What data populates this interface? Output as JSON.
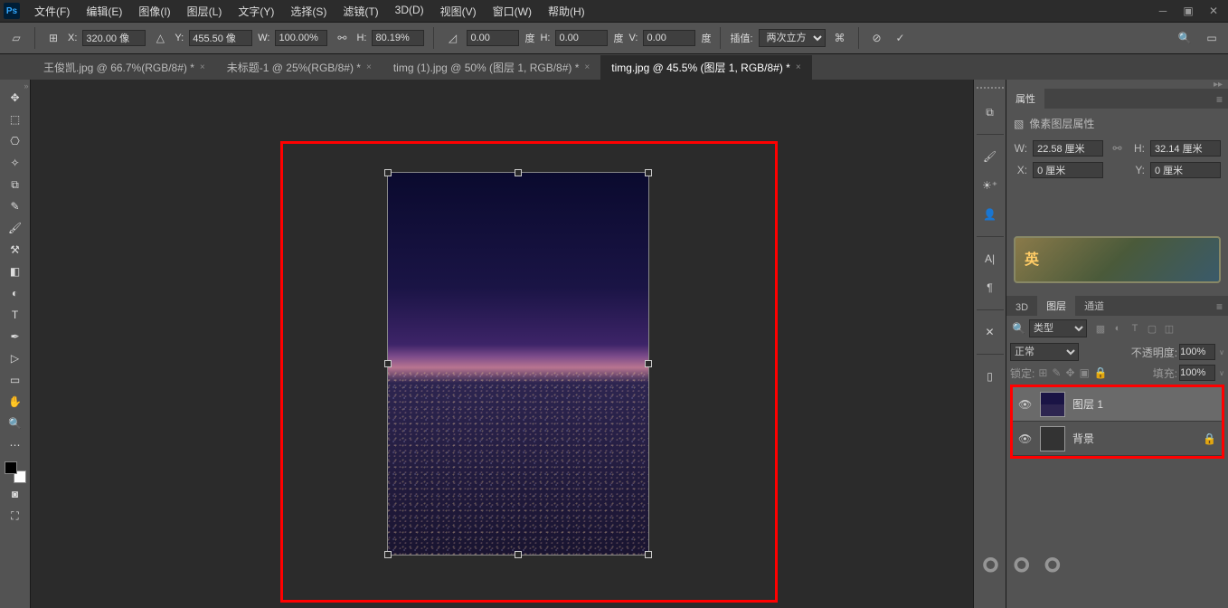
{
  "menu": {
    "file": "文件(F)",
    "edit": "编辑(E)",
    "image": "图像(I)",
    "layer": "图层(L)",
    "type": "文字(Y)",
    "select": "选择(S)",
    "filter": "滤镜(T)",
    "threeD": "3D(D)",
    "view": "视图(V)",
    "window": "窗口(W)",
    "help": "帮助(H)"
  },
  "options": {
    "x_label": "X:",
    "x_value": "320.00 像",
    "y_label": "Y:",
    "y_value": "455.50 像",
    "w_label": "W:",
    "w_value": "100.00%",
    "h_label": "H:",
    "h_value": "80.19%",
    "angle_value": "0.00",
    "h2_label": "H:",
    "h2_value": "0.00",
    "deg1": "度",
    "v_label": "V:",
    "v_value": "0.00",
    "deg2": "度",
    "interp_label": "插值:",
    "interp_value": "两次立方"
  },
  "tabs": [
    {
      "label": "王俊凯.jpg @ 66.7%(RGB/8#) *",
      "active": false
    },
    {
      "label": "未标题-1 @ 25%(RGB/8#) *",
      "active": false
    },
    {
      "label": "timg (1).jpg @ 50% (图层 1, RGB/8#) *",
      "active": false
    },
    {
      "label": "timg.jpg @ 45.5% (图层 1, RGB/8#) *",
      "active": true
    }
  ],
  "panels": {
    "properties_tab": "属性",
    "pixel_layer_props": "像素图层属性",
    "w_label": "W:",
    "w_value": "22.58 厘米",
    "h_label": "H:",
    "h_value": "32.14 厘米",
    "x_label": "X:",
    "x_value": "0 厘米",
    "y_label": "Y:",
    "y_value": "0 厘米",
    "threeD_tab": "3D",
    "layers_tab": "图层",
    "channels_tab": "通道",
    "filter_kind_label": "类型",
    "blend_mode": "正常",
    "opacity_label": "不透明度:",
    "opacity_value": "100%",
    "lock_label": "锁定:",
    "fill_label": "填充:",
    "fill_value": "100%",
    "layer1_name": "图层 1",
    "bg_layer_name": "背景"
  }
}
